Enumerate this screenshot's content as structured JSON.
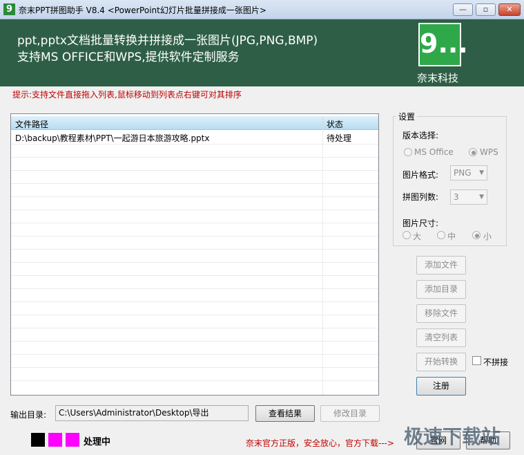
{
  "window": {
    "title": "奈末PPT拼图助手 V8.4 <PowerPoint幻灯片批量拼接成一张图片>",
    "icon_glyph": "9",
    "controls": {
      "minimize": "—",
      "restore": "▫",
      "close": "✕"
    }
  },
  "banner": {
    "line1": "ppt,pptx文档批量转换并拼接成一张图片(JPG,PNG,BMP)",
    "line2": "支持MS OFFICE和WPS,提供软件定制服务",
    "logo_glyph": "9...",
    "logo_text": "奈末科技"
  },
  "hint": "提示:支持文件直接拖入列表,鼠标移动到列表点右键可对其排序",
  "file_list": {
    "columns": [
      "文件路径",
      "状态"
    ],
    "rows": [
      {
        "path": "D:\\backup\\教程素材\\PPT\\一起游日本旅游攻略.pptx",
        "status": "待处理"
      }
    ]
  },
  "settings": {
    "legend": "设置",
    "version_label": "版本选择:",
    "version_options": [
      "MS Office",
      "WPS"
    ],
    "version_selected": "WPS",
    "format_label": "图片格式:",
    "format_value": "PNG",
    "columns_label": "拼图列数:",
    "columns_value": "3",
    "size_label": "图片尺寸:",
    "size_options": [
      "大",
      "中",
      "小"
    ],
    "size_selected": "小"
  },
  "buttons": {
    "add_file": "添加文件",
    "add_dir": "添加目录",
    "remove_file": "移除文件",
    "clear_list": "清空列表",
    "start_convert": "开始转换",
    "register": "注册",
    "view_result": "查看结果",
    "change_dir": "修改目录"
  },
  "no_stitch_label": "不拼接",
  "output": {
    "label": "输出目录:",
    "path": "C:\\Users\\Administrator\\Desktop\\导出"
  },
  "status": {
    "text": "处理中",
    "colors": [
      "#000000",
      "#ff00ff",
      "#ff00ff"
    ]
  },
  "footer": {
    "promo": "奈末官方正版，安全放心，官方下载--->",
    "btn1_fragment": "官网",
    "btn2_fragment": "帮助"
  },
  "watermark": "极速下载站"
}
